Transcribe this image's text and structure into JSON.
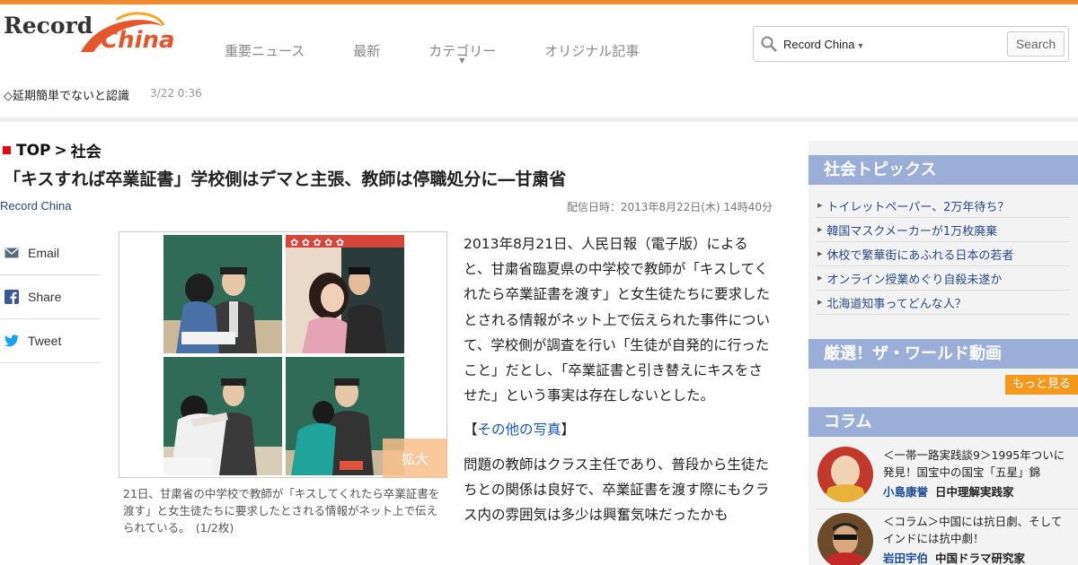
{
  "brand": {
    "logo_word1": "Record",
    "logo_word2": "China",
    "accent": "#f08a2b",
    "logo_red": "#e4572e"
  },
  "nav": {
    "items": [
      "重要ニュース",
      "最新",
      "カテゴリー",
      "オリジナル記事"
    ]
  },
  "search": {
    "scope": "Record China",
    "button": "Search",
    "placeholder": ""
  },
  "ticker": {
    "text": "◇延期簡単でないと認識",
    "time": "3/22 0:36"
  },
  "breadcrumb": {
    "top": "TOP",
    "sep": ">",
    "section": "社会"
  },
  "article": {
    "title": "「キスすれば卒業証書」学校側はデマと主張、教師は停職処分に―甘粛省",
    "source": "Record China",
    "date": "配信日時：2013年8月22日(木) 14時40分",
    "paragraphs": [
      "2013年8月21日、人民日報（電子版）によると、甘粛省臨夏県の中学校で教師が「キスしてくれたら卒業証書を渡す」と女生徒たちに要求したとされる情報がネット上で伝えられた事件について、学校側が調査を行い「生徒が自発的に行ったこと」だとし、「卒業証書と引き替えにキスをさせた」という事実は存在しないとした。",
      "問題の教師はクラス主任であり、普段から生徒たちとの関係は良好で、卒業証書を渡す際にもクラス内の雰囲気は多少は興奮気味だったかも"
    ],
    "more_photos_open": "【",
    "more_photos_link": "その他の写真",
    "more_photos_close": "】",
    "photo_zoom": "拡大",
    "caption": "21日、甘粛省の中学校で教師が「キスしてくれたら卒業証書を渡す」と女生徒たちに要求したとされる情報がネット上で伝えられている。　(1/2枚)"
  },
  "share": {
    "email": "Email",
    "facebook": "Share",
    "twitter": "Tweet"
  },
  "sidebar": {
    "topics_title": "社会トピックス",
    "topics": [
      "トイレットペーパー、2万年待ち？",
      "韓国マスクメーカーが1万枚廃棄",
      "休校で繁華街にあふれる日本の若者",
      "オンライン授業めぐり自殺未遂か",
      "北海道知事ってどんな人？"
    ],
    "video_title": "厳選！ザ・ワールド動画",
    "more_label": "もっと見る",
    "column_title": "コラム",
    "columns": [
      {
        "title": "＜一帯一路実践談9＞1995年ついに発見！国宝中の国宝「五星」錦",
        "author": "小島康誉",
        "org": "日中理解実践家"
      },
      {
        "title": "＜コラム＞中国には抗日劇、そしてインドには抗中劇！",
        "author": "岩田宇伯",
        "org": "中国ドラマ研究家"
      }
    ]
  }
}
